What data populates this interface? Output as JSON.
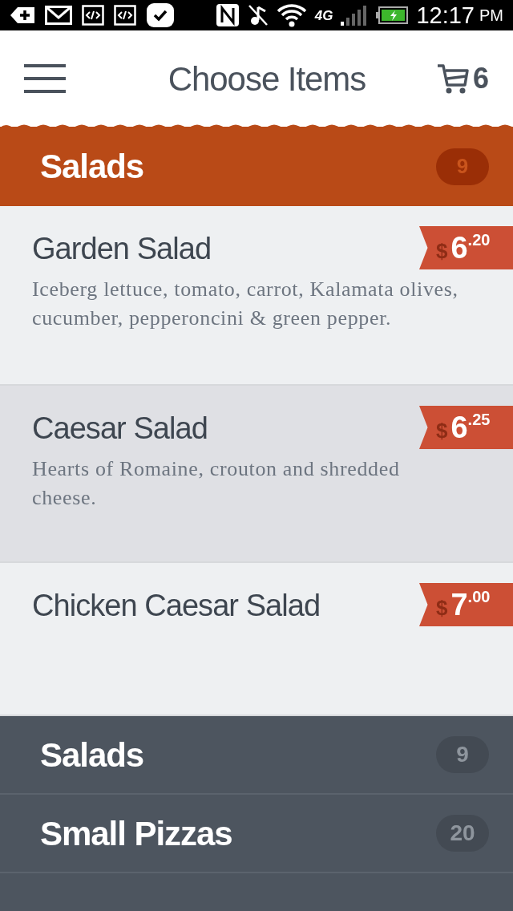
{
  "status_bar": {
    "time": "12:17",
    "period": "PM",
    "network": "4G"
  },
  "header": {
    "title": "Choose Items",
    "cart_count": "6"
  },
  "category": {
    "name": "Salads",
    "count": "9"
  },
  "items": [
    {
      "name": "Garden Salad",
      "description": "Iceberg lettuce, tomato, carrot, Kalamata olives, cucumber, pepperoncini & green pepper.",
      "price": {
        "currency": "$",
        "whole": "6",
        "cents": ".20"
      },
      "selected": false
    },
    {
      "name": "Caesar Salad",
      "description": "Hearts of Romaine, crouton and shredded cheese.",
      "price": {
        "currency": "$",
        "whole": "6",
        "cents": ".25"
      },
      "selected": true
    },
    {
      "name": "Chicken Caesar Salad",
      "price": {
        "currency": "$",
        "whole": "7",
        "cents": ".00"
      },
      "selected": false
    }
  ],
  "category_menu": [
    {
      "name": "Salads",
      "count": "9"
    },
    {
      "name": "Small Pizzas",
      "count": "20"
    }
  ]
}
